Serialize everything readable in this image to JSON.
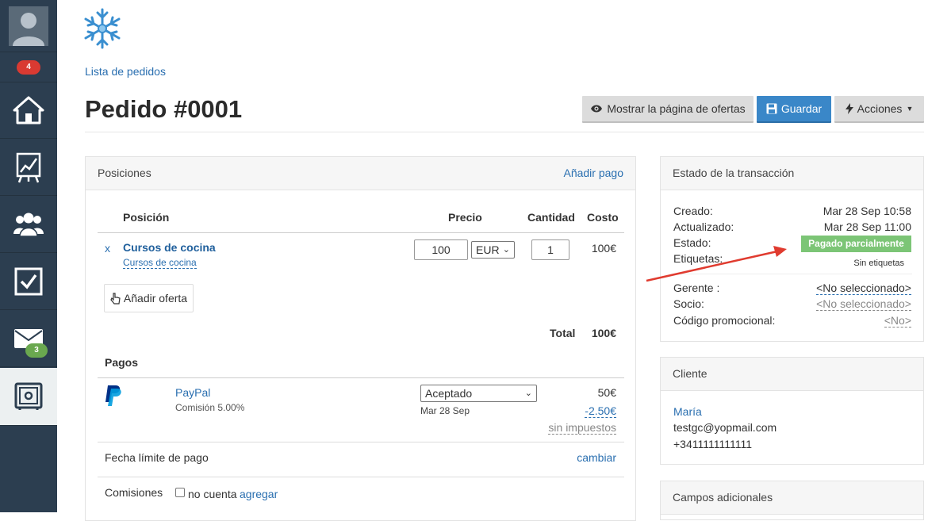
{
  "sidebar": {
    "avatar": "user-avatar-icon",
    "notif_count": "4",
    "items": [
      {
        "icon": "home-icon"
      },
      {
        "icon": "presentation-chart-icon"
      },
      {
        "icon": "users-group-icon"
      },
      {
        "icon": "checkbox-icon"
      },
      {
        "icon": "mail-icon",
        "badge": "3"
      },
      {
        "icon": "safe-icon"
      }
    ]
  },
  "header": {
    "breadcrumb": "Lista de pedidos",
    "title": "Pedido #0001",
    "btn_offers": "Mostrar la página de ofertas",
    "btn_save": "Guardar",
    "btn_actions": "Acciones"
  },
  "positions": {
    "title": "Posiciones",
    "add_payment": "Añadir pago",
    "col_position": "Posición",
    "col_price": "Precio",
    "col_qty": "Cantidad",
    "col_cost": "Costo",
    "item": {
      "remove": "x",
      "name": "Cursos de cocina",
      "sub": "Cursos de cocina",
      "price": "100",
      "currency": "EUR",
      "qty": "1",
      "cost": "100€"
    },
    "add_offer": "Añadir oferta",
    "total_label": "Total",
    "total_value": "100€",
    "payments_title": "Pagos",
    "payment": {
      "provider": "PayPal",
      "commission": "Comisión 5.00%",
      "status": "Aceptado",
      "date": "Mar 28 Sep",
      "amount": "50€",
      "fee": "-2.50€",
      "tax": "sin impuestos"
    },
    "due_label": "Fecha límite de pago",
    "due_action": "cambiar",
    "commissions_label": "Comisiones",
    "commissions_check": "no cuenta",
    "commissions_add": "agregar"
  },
  "transaction": {
    "title": "Estado de la transacción",
    "created_label": "Creado:",
    "created_value": "Mar 28 Sep 10:58",
    "updated_label": "Actualizado:",
    "updated_value": "Mar 28 Sep 11:00",
    "status_label": "Estado:",
    "status_value": "Pagado parcialmente",
    "tags_label": "Etiquetas:",
    "tags_value": "Sin etiquetas",
    "manager_label": "Gerente :",
    "manager_value": "<No seleccionado>",
    "partner_label": "Socio:",
    "partner_value": "<No seleccionado>",
    "promo_label": "Código promocional:",
    "promo_value": "<No>"
  },
  "client": {
    "title": "Cliente",
    "name": "María",
    "email": "testgc@yopmail.com",
    "phone": "+3411111111111"
  },
  "extra": {
    "title": "Campos adicionales"
  },
  "colors": {
    "sidebar": "#2c3e50",
    "primary": "#3a87c8",
    "link": "#2a6fb0",
    "status_green": "#7cc576",
    "annotation_arrow": "#e03b2f"
  }
}
